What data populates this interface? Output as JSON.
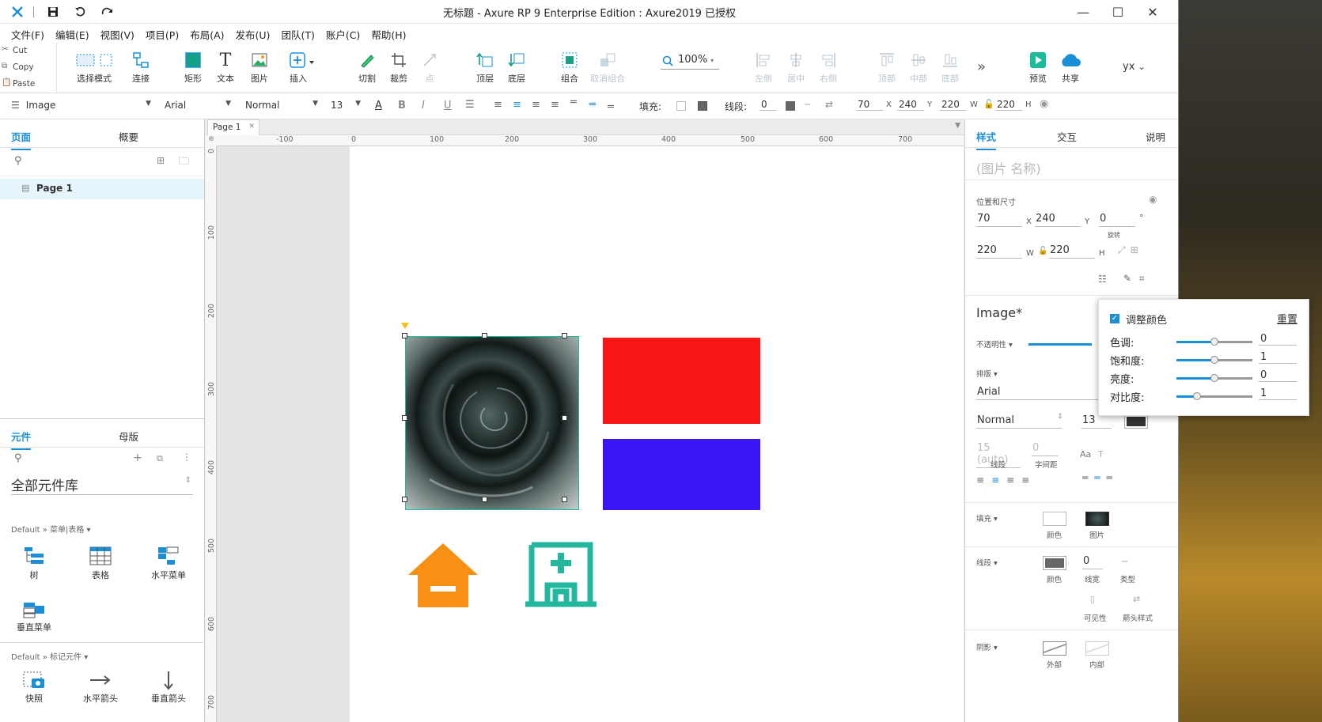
{
  "window": {
    "title": "无标题 - Axure RP 9 Enterprise Edition : Axure2019 已授权"
  },
  "menu": [
    "文件(F)",
    "编辑(E)",
    "视图(V)",
    "项目(P)",
    "布局(A)",
    "发布(U)",
    "团队(T)",
    "账户(C)",
    "帮助(H)"
  ],
  "clipboard": {
    "cut": "Cut",
    "copy": "Copy",
    "paste": "Paste"
  },
  "tools": {
    "select_mode": "选择模式",
    "connect": "连接",
    "rect": "矩形",
    "text": "文本",
    "image": "图片",
    "insert": "插入",
    "cut": "切割",
    "crop": "裁剪",
    "point": "点",
    "top_layer": "顶层",
    "bottom_layer": "底层",
    "group": "组合",
    "ungroup": "取消组合",
    "zoom": "100%",
    "left": "左侧",
    "center": "居中",
    "right": "右侧",
    "top": "顶部",
    "middle": "中部",
    "bottom": "底部",
    "preview": "预览",
    "share": "共享",
    "user": "yx"
  },
  "format": {
    "style": "Image",
    "font": "Arial",
    "weight": "Normal",
    "size": "13",
    "fill_label": "填充:",
    "stroke_label": "线段:",
    "stroke_val": "0",
    "x": "70",
    "y": "240",
    "w": "220",
    "h": "220"
  },
  "left": {
    "tabs": [
      "页面",
      "概要"
    ],
    "pages": [
      {
        "name": "Page 1"
      }
    ],
    "lib_tabs": [
      "元件",
      "母版"
    ],
    "lib_name": "全部元件库",
    "group1": "Default » 菜单|表格 ▾",
    "widgets1": [
      "树",
      "表格",
      "水平菜单",
      "垂直菜单"
    ],
    "group2": "Default » 标记元件 ▾",
    "widgets2": [
      "快照",
      "水平箭头",
      "垂直箭头"
    ]
  },
  "canvas": {
    "tab": "Page 1",
    "hticks": [
      "-100",
      "0",
      "100",
      "200",
      "300",
      "400",
      "500",
      "600",
      "700"
    ],
    "vticks": [
      "0",
      "100",
      "200",
      "300",
      "400",
      "500",
      "600",
      "700"
    ],
    "shape_colors": {
      "red": "#f61616",
      "blue": "#3a14f2",
      "orange": "#f79015",
      "teal": "#22b8a0"
    }
  },
  "right": {
    "tabs": [
      "样式",
      "交互",
      "说明"
    ],
    "name_placeholder": "(图片 名称)",
    "pos_size": "位置和尺寸",
    "x": "70",
    "y": "240",
    "rot": "0",
    "rot_unit": "°",
    "rot_label": "旋转",
    "w": "220",
    "h": "220",
    "lbl_x": "X",
    "lbl_y": "Y",
    "lbl_w": "W",
    "lbl_h": "H",
    "style_name": "Image*",
    "opacity": "不透明性 ▾",
    "typography": "排版 ▾",
    "font": "Arial",
    "weight": "Normal",
    "size": "13",
    "line_h": "15 (auto)",
    "letter": "0",
    "line_lbl": "线段",
    "letter_lbl": "字间距",
    "fill": "填充 ▾",
    "fill_color": "颜色",
    "fill_image": "图片",
    "stroke": "线段 ▾",
    "stroke_color": "颜色",
    "stroke_w": "0",
    "stroke_w_lbl": "线宽",
    "stroke_type": "类型",
    "visible": "可见性",
    "arrow": "箭头样式",
    "shadow": "阴影 ▾",
    "outer": "外部",
    "inner": "内部"
  },
  "popup": {
    "title": "调整颜色",
    "reset": "重置",
    "rows": [
      {
        "label": "色调:",
        "value": "0",
        "pos": 0.5
      },
      {
        "label": "饱和度:",
        "value": "1",
        "pos": 0.5
      },
      {
        "label": "亮度:",
        "value": "0",
        "pos": 0.5
      },
      {
        "label": "对比度:",
        "value": "1",
        "pos": 0.27
      }
    ]
  }
}
